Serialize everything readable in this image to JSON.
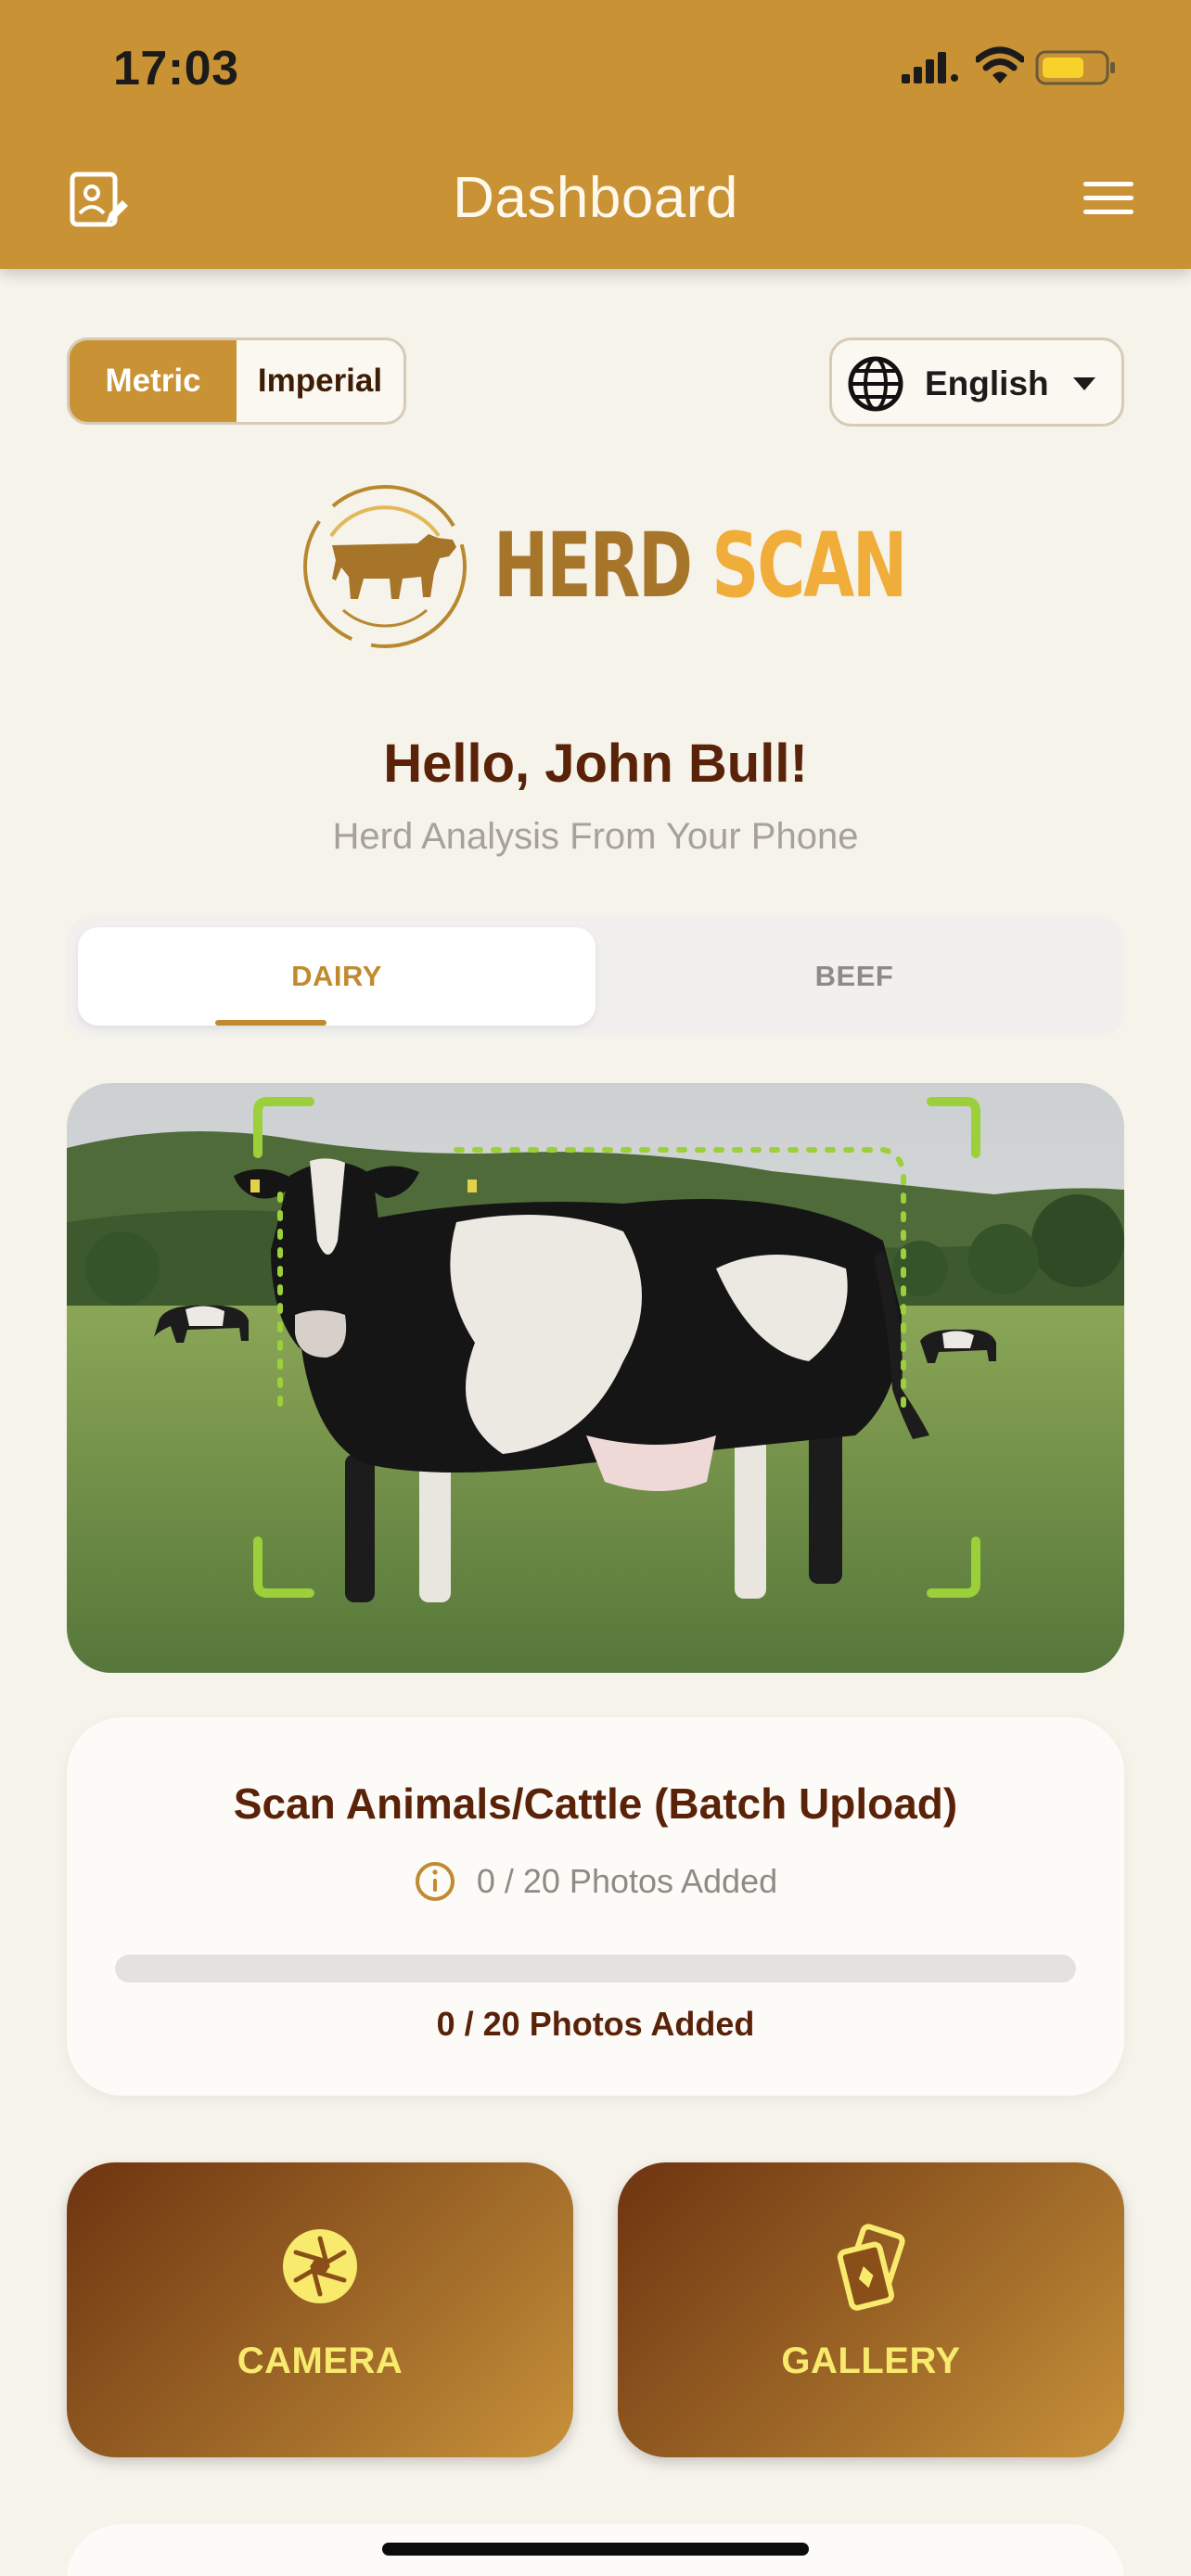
{
  "status_bar": {
    "time": "17:03"
  },
  "nav": {
    "title": "Dashboard"
  },
  "units": {
    "options": [
      "Metric",
      "Imperial"
    ],
    "selected": "Metric"
  },
  "language": {
    "selected": "English"
  },
  "logo": {
    "word1": "HERD",
    "word2": "SCAN"
  },
  "greeting": "Hello, John Bull!",
  "tagline": "Herd Analysis From Your Phone",
  "tabs": [
    {
      "label": "DAIRY",
      "active": true
    },
    {
      "label": "BEEF",
      "active": false
    }
  ],
  "scan_card": {
    "title": "Scan Animals/Cattle (Batch Upload)",
    "info_text": "0 / 20 Photos Added",
    "progress_label": "0 / 20 Photos Added",
    "progress": 0
  },
  "actions": {
    "camera_label": "CAMERA",
    "gallery_label": "GALLERY"
  },
  "colors": {
    "header": "#c99234",
    "accent": "#c28a30",
    "text_dark": "#5a2208",
    "action_label": "#f7ea6d",
    "scan_frame": "#9bd03a"
  },
  "icons": {
    "edit": "edit-profile-icon",
    "menu": "hamburger-menu-icon",
    "language": "globe-icon",
    "info": "info-icon",
    "camera": "camera-aperture-icon",
    "gallery": "gallery-cards-icon"
  }
}
